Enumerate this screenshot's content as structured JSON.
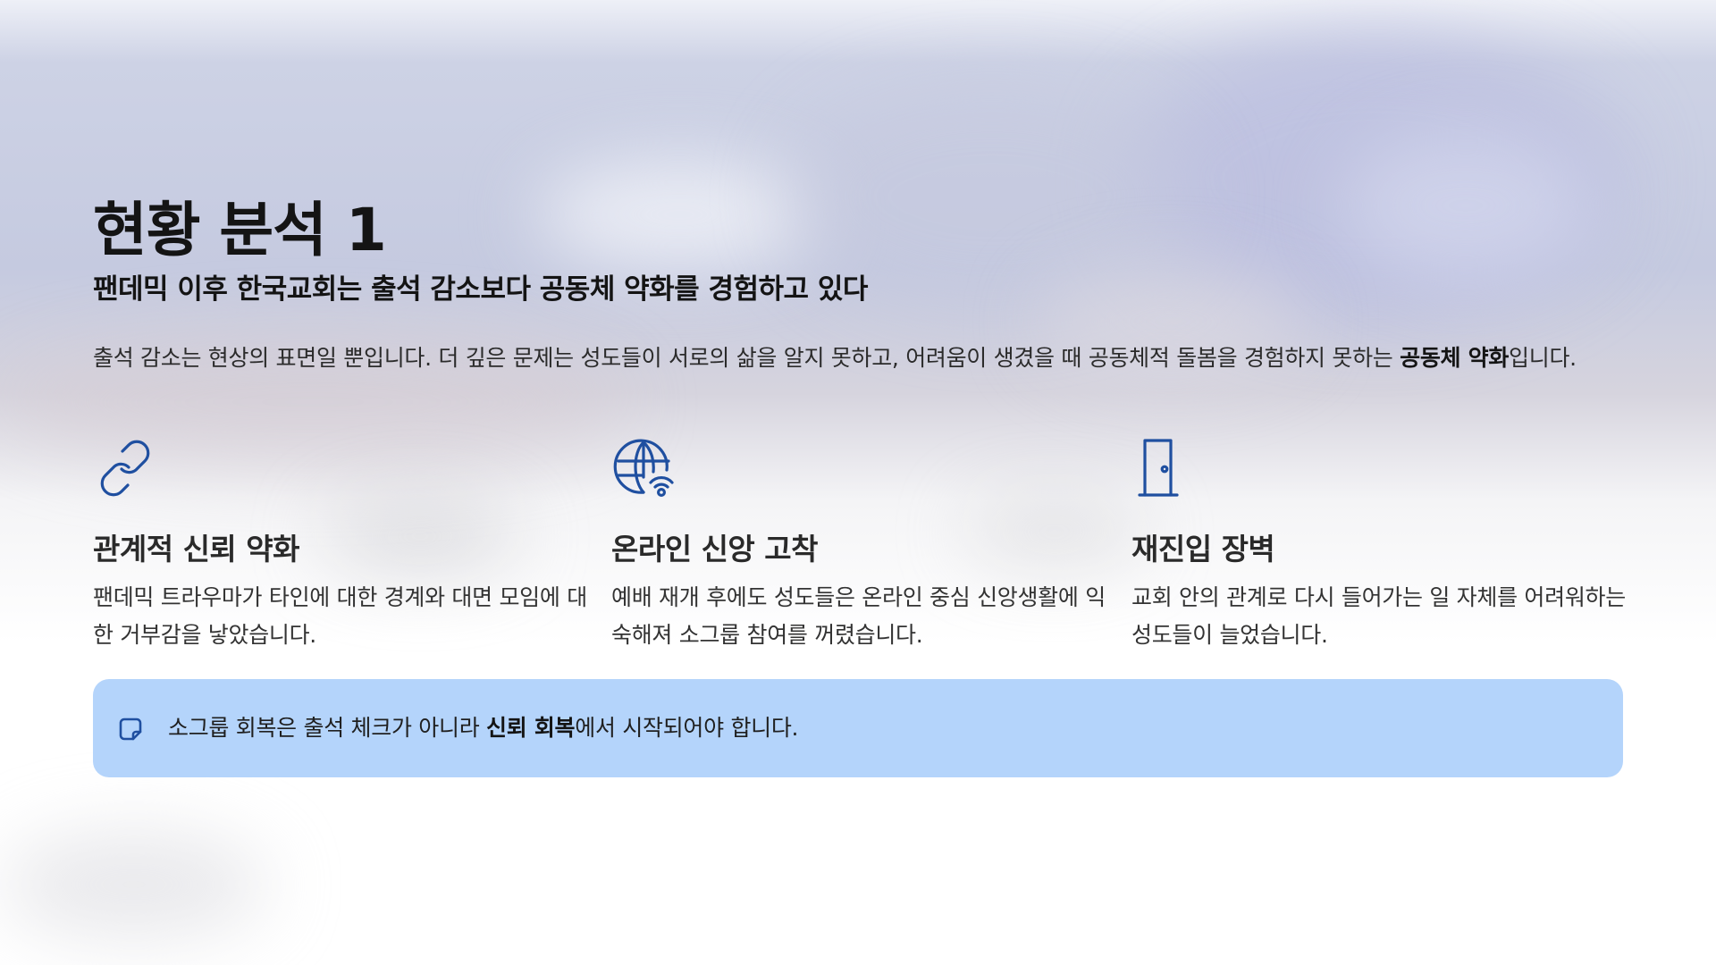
{
  "slide": {
    "title": "현황 분석 1",
    "subtitle": "팬데믹 이후 한국교회는 출석 감소보다 공동체 약화를 경험하고 있다",
    "intro": {
      "text_before": "출석 감소는 현상의 표면일 뿐입니다. 더 깊은 문제는 성도들이 서로의 삶을 알지 못하고, 어려움이 생겼을 때 공동체적 돌봄을 경험하지 못하는 ",
      "emphasis": "공동체 약화",
      "text_after": "입니다."
    },
    "cards": [
      {
        "icon": "chain-link-icon",
        "heading": "관계적 신뢰 약화",
        "body": "팬데믹 트라우마가 타인에 대한 경계와 대면 모임에 대한 거부감을 낳았습니다."
      },
      {
        "icon": "globe-wifi-icon",
        "heading": "온라인 신앙 고착",
        "body": "예배 재개 후에도 성도들은 온라인 중심 신앙생활에 익숙해져 소그룹 참여를 꺼렸습니다."
      },
      {
        "icon": "door-icon",
        "heading": "재진입 장벽",
        "body": "교회 안의 관계로 다시 들어가는 일 자체를 어려워하는 성도들이 늘었습니다."
      }
    ],
    "callout": {
      "icon": "note-icon",
      "text_before": "소그룹 회복은 출석 체크가 아니라 ",
      "emphasis": "신뢰 회복",
      "text_after": "에서 시작되어야 합니다."
    },
    "colors": {
      "icon_blue": "#1f4fa0",
      "callout_bg": "#b4d4fb"
    }
  }
}
